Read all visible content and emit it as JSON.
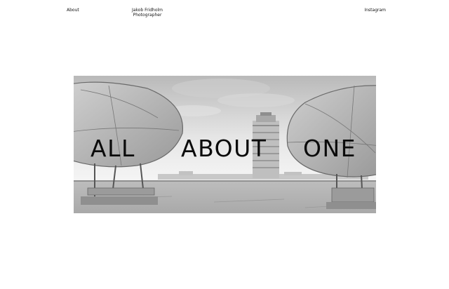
{
  "header": {
    "about_label": "About",
    "brand_name": "Jakob Fridholm",
    "brand_role": "Photographer",
    "instagram_label": "Instagram"
  },
  "hero": {
    "title_words": [
      "ALL",
      "ABOUT",
      "ONE"
    ],
    "image": "rooftop-satellite-dishes-photo"
  },
  "colors": {
    "background": "#ffffff",
    "text": "#111111",
    "photo_tone": "grayscale"
  }
}
